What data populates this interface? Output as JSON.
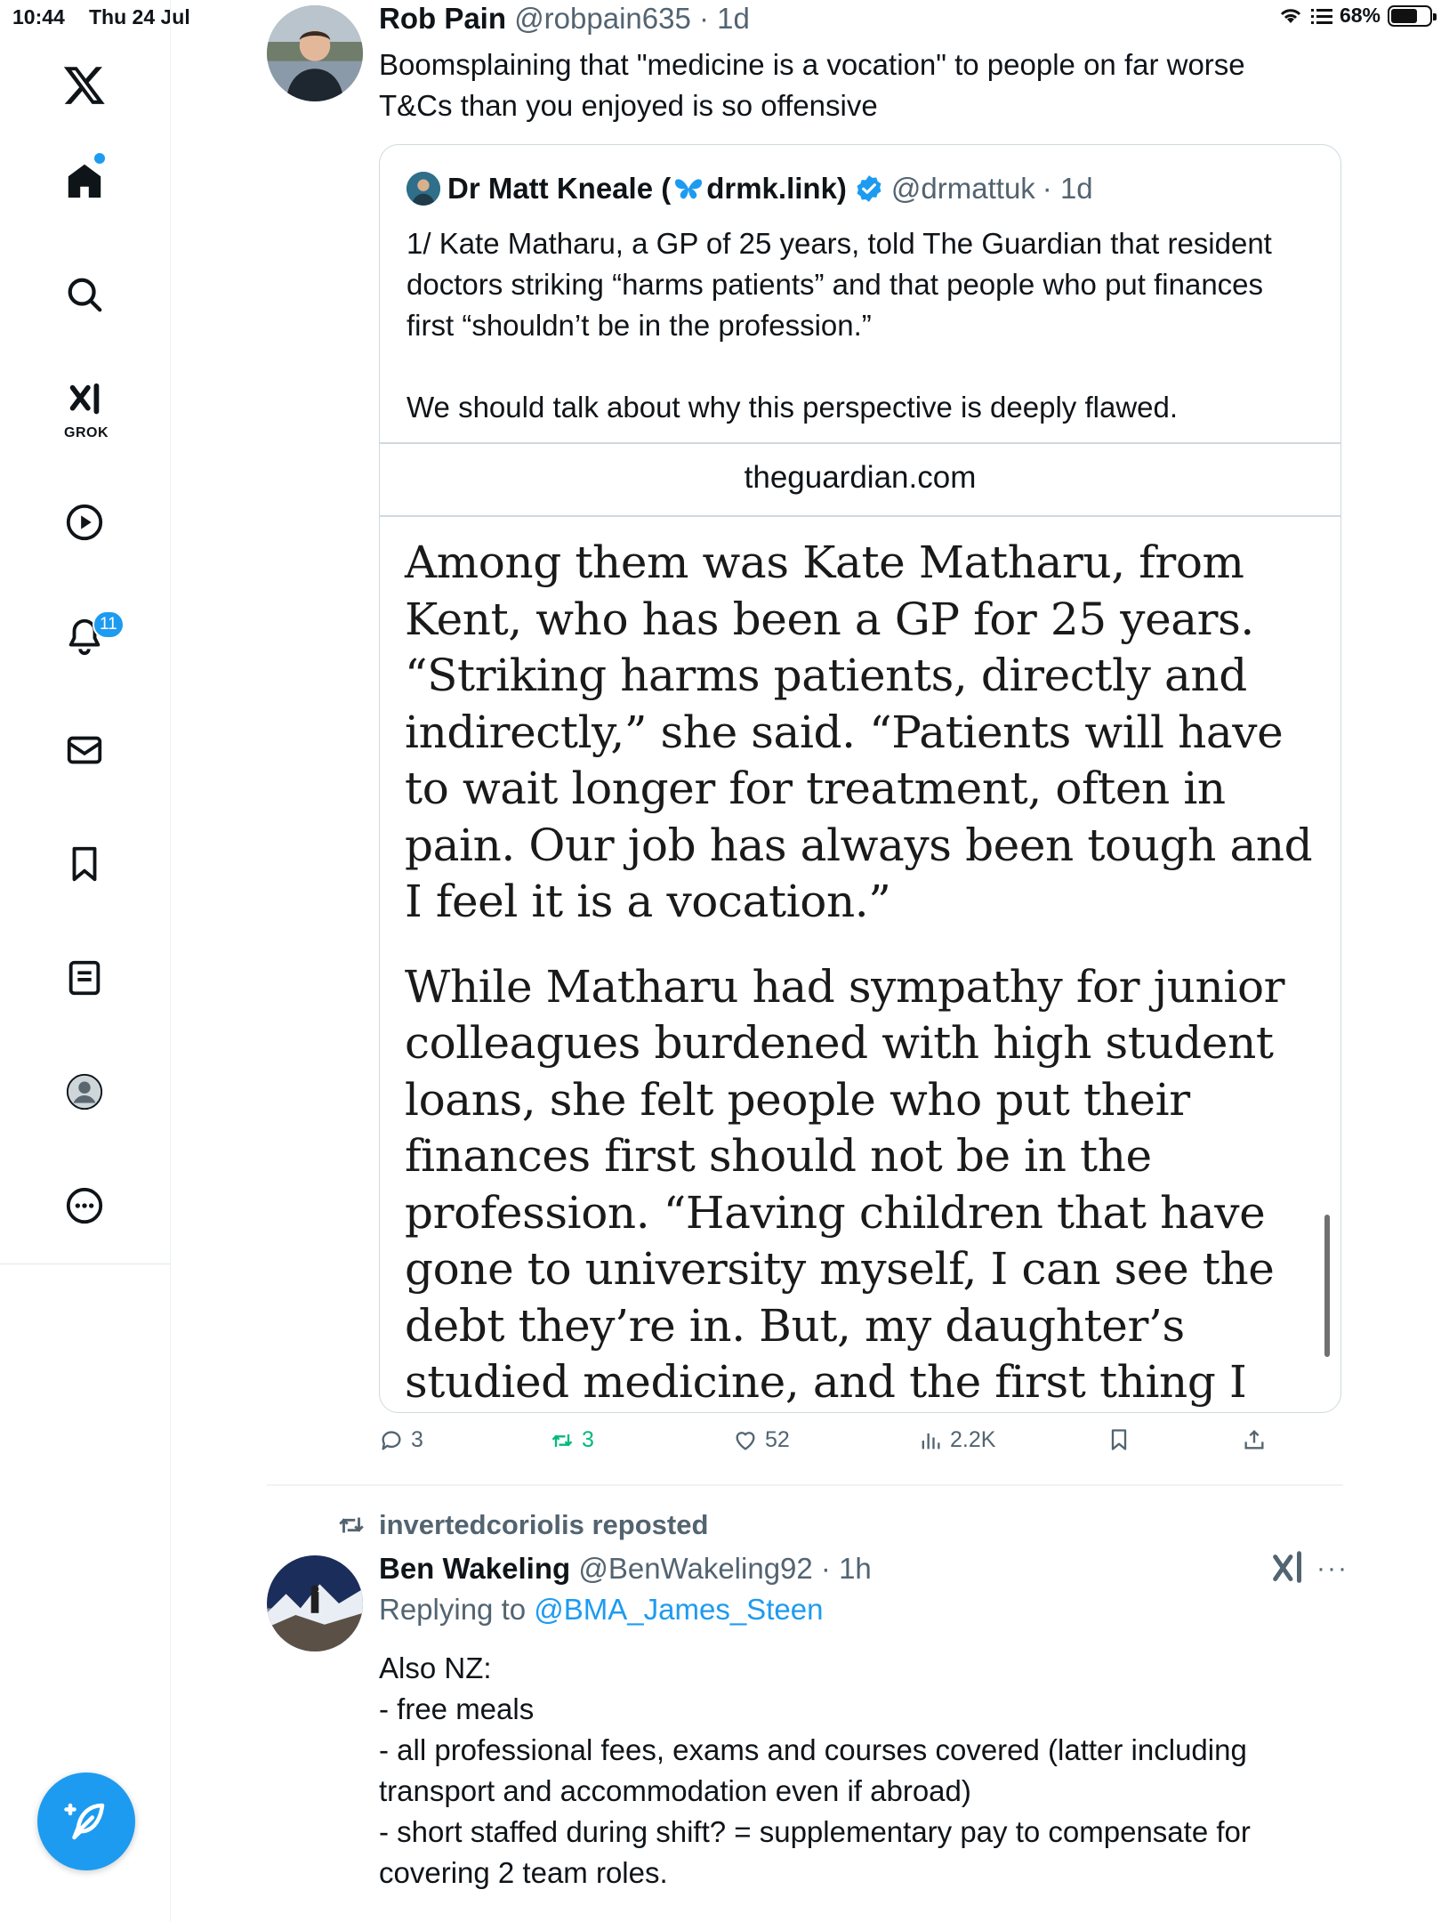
{
  "status_bar": {
    "time": "10:44",
    "date": "Thu 24 Jul",
    "battery": "68%",
    "battery_level": 0.68
  },
  "sidebar": {
    "logo": "x-logo-icon",
    "items": [
      {
        "name": "home",
        "icon": "home-icon"
      },
      {
        "name": "search",
        "icon": "search-icon"
      },
      {
        "name": "grok",
        "icon": "grok-icon",
        "label": "GROK"
      },
      {
        "name": "videos",
        "icon": "play-icon"
      },
      {
        "name": "notifications",
        "icon": "bell-icon",
        "badge": "11"
      },
      {
        "name": "messages",
        "icon": "mail-icon"
      },
      {
        "name": "bookmarks",
        "icon": "bookmark-icon"
      },
      {
        "name": "lists",
        "icon": "list-icon"
      },
      {
        "name": "profile",
        "icon": "profile-icon"
      },
      {
        "name": "more",
        "icon": "more-icon"
      }
    ],
    "compose_icon": "compose-icon",
    "accent_color": "#1d9bf0"
  },
  "tweet1": {
    "name": "Rob Pain",
    "handle": "@robpain635",
    "time": "· 1d",
    "text_line1": "Boomsplaining that \"medicine is a vocation\" to people on far worse",
    "text_line2": "T&Cs than you enjoyed is so offensive",
    "quote": {
      "name": "Dr Matt Kneale (",
      "name_link": "drmk.link)",
      "handle": "@drmattuk",
      "time": "· 1d",
      "text_p1": "1/ Kate Matharu, a GP of 25 years, told The Guardian that resident doctors striking “harms patients” and that people who put finances first “shouldn’t be in the profession.”",
      "text_p2": "We should talk about why this perspective is deeply flawed.",
      "domain": "theguardian.com",
      "article_p1": "Among them was Kate Matharu, from Kent, who has been a GP for 25 years. “Striking harms patients, directly and indirectly,” she said. “Patients will have to wait longer for treatment, often in pain. Our job has always been tough and I feel it is a vocation.”",
      "article_p2": "While Matharu had sympathy for junior colleagues burdened with high student loans, she felt people who put their finances first should not be in the profession. “Having children that have gone to university myself, I can see the debt they’re in. But, my daughter’s studied medicine, and the first thing I said to her is: don’t do it if you want to earn lots of money, if that is your main concern.”"
    },
    "actions": {
      "replies": "3",
      "reposts": "3",
      "likes": "52",
      "views": "2.2K"
    }
  },
  "tweet2": {
    "reposted_by": "invertedcoriolis reposted",
    "name": "Ben Wakeling",
    "handle": "@BenWakeling92",
    "time": "· 1h",
    "replying_prefix": "Replying to ",
    "replying_to": "@BMA_James_Steen",
    "lines": [
      "Also NZ:",
      "- free meals",
      "- all professional fees, exams and courses covered (latter including",
      "transport and accommodation even if abroad)",
      "- short staffed during shift? = supplementary pay to compensate for",
      "covering 2 team roles."
    ],
    "more_label": "···"
  }
}
